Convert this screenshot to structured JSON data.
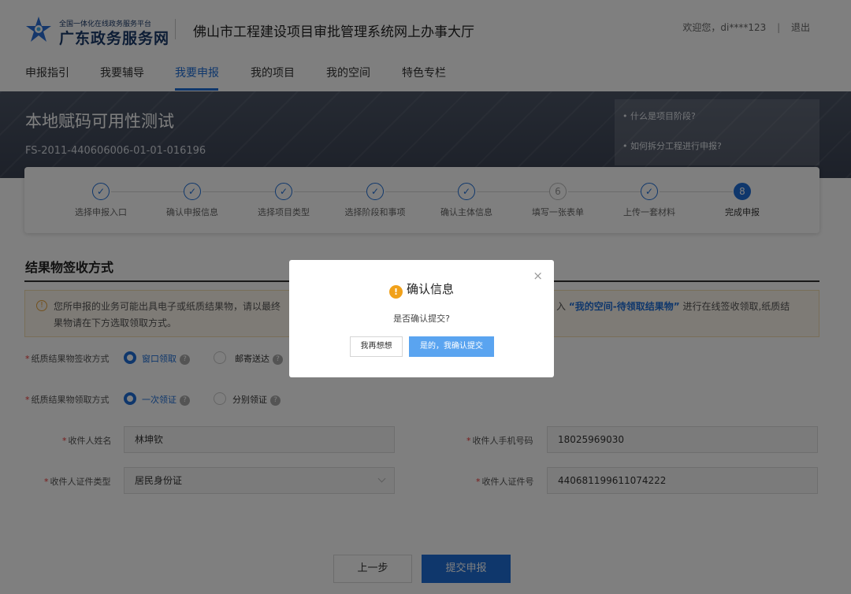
{
  "colors": {
    "primary": "#1f6fd8",
    "warning": "#f1a11a",
    "banner": "#454d5e"
  },
  "header": {
    "platform_small": "全国一体化在线政务服务平台",
    "platform_name": "广东政务服务网",
    "site_title": "佛山市工程建设项目审批管理系统网上办事大厅",
    "welcome": "欢迎您，di****123",
    "separator": "|",
    "logout": "退出"
  },
  "nav": [
    {
      "label": "申报指引",
      "active": false
    },
    {
      "label": "我要辅导",
      "active": false
    },
    {
      "label": "我要申报",
      "active": true
    },
    {
      "label": "我的项目",
      "active": false
    },
    {
      "label": "我的空间",
      "active": false
    },
    {
      "label": "特色专栏",
      "active": false
    }
  ],
  "banner": {
    "project_name": "本地赋码可用性测试",
    "project_code": "FS-2011-440606006-01-01-016196",
    "help_links": [
      "• 什么是项目阶段?",
      "• 如何拆分工程进行申报?"
    ]
  },
  "steps": [
    {
      "label": "选择申报入口",
      "icon": "check-icon",
      "state": "done"
    },
    {
      "label": "确认申报信息",
      "icon": "check-icon",
      "state": "done"
    },
    {
      "label": "选择项目类型",
      "icon": "check-icon",
      "state": "done"
    },
    {
      "label": "选择阶段和事项",
      "icon": "check-icon",
      "state": "done"
    },
    {
      "label": "确认主体信息",
      "icon": "check-icon",
      "state": "done"
    },
    {
      "label": "填写一张表单",
      "icon": "6",
      "state": "pending"
    },
    {
      "label": "上传一套材料",
      "icon": "check-icon",
      "state": "done"
    },
    {
      "label": "完成申报",
      "icon": "8",
      "state": "current"
    }
  ],
  "section": {
    "title": "结果物签收方式",
    "notice_line1": "您所申报的业务可能出具电子或纸质结果物，请以最终",
    "notice_line2": "果物请在下方选取领取方式。",
    "notice_right_prefix": "入",
    "notice_right_link": "“我的空间-待领取结果物”",
    "notice_right_suffix": "进行在线签收领取,纸质结"
  },
  "form": {
    "receive_method": {
      "label": "纸质结果物签收方式",
      "options": [
        "窗口领取",
        "邮寄送达"
      ],
      "selected": "窗口领取"
    },
    "collect_method": {
      "label": "纸质结果物领取方式",
      "options": [
        "一次领证",
        "分别领证"
      ],
      "selected": "一次领证"
    },
    "recipient_name": {
      "label": "收件人姓名",
      "value": "林坤钦"
    },
    "recipient_phone": {
      "label": "收件人手机号码",
      "value": "18025969030"
    },
    "id_type": {
      "label": "收件人证件类型",
      "value": "居民身份证"
    },
    "id_number": {
      "label": "收件人证件号",
      "value": "440681199611074222"
    },
    "required_mark": "*",
    "help_mark": "?"
  },
  "actions": {
    "prev": "上一步",
    "submit": "提交申报"
  },
  "modal": {
    "title": "确认信息",
    "warn_symbol": "!",
    "message": "是否确认提交?",
    "cancel": "我再想想",
    "confirm": "是的，我确认提交",
    "close_symbol": "×"
  }
}
